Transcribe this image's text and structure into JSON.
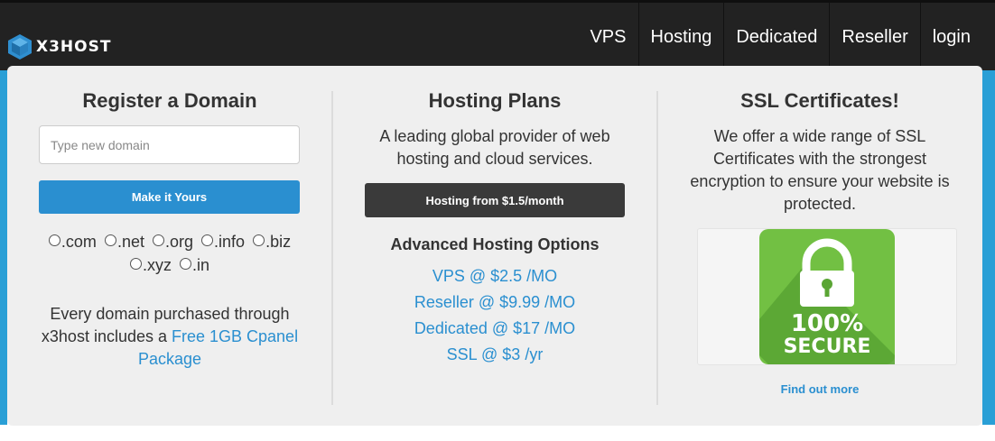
{
  "header": {
    "brand": "X3HOST",
    "nav": [
      "VPS",
      "Hosting",
      "Dedicated",
      "Reseller",
      "login"
    ]
  },
  "domain": {
    "title": "Register a Domain",
    "input_placeholder": "Type new domain",
    "button": "Make it Yours",
    "tlds": [
      ".com",
      ".net",
      ".org",
      ".info",
      ".biz",
      ".xyz",
      ".in"
    ],
    "promo_text": "Every domain purchased through x3host includes a ",
    "promo_link": "Free 1GB Cpanel Package"
  },
  "hosting": {
    "title": "Hosting Plans",
    "description": "A leading global provider of web hosting and cloud services.",
    "button": "Hosting from $1.5/month",
    "options_title": "Advanced Hosting Options",
    "options": [
      "VPS @ $2.5 /MO",
      "Reseller @ $9.99 /MO",
      "Dedicated @ $17 /MO",
      "SSL @ $3 /yr"
    ]
  },
  "ssl": {
    "title": "SSL Certificates!",
    "description": "We offer a wide range of SSL Certificates with the strongest encryption to ensure your website is protected.",
    "badge_line1": "100%",
    "badge_line2": "SECURE",
    "link": "Find out more"
  },
  "colors": {
    "navbar": "#222222",
    "accent_blue": "#2a8fd0",
    "panel": "#efefef",
    "badge_green": "#72c043"
  },
  "icons": [
    "x3host-logo-icon",
    "lock-icon"
  ]
}
